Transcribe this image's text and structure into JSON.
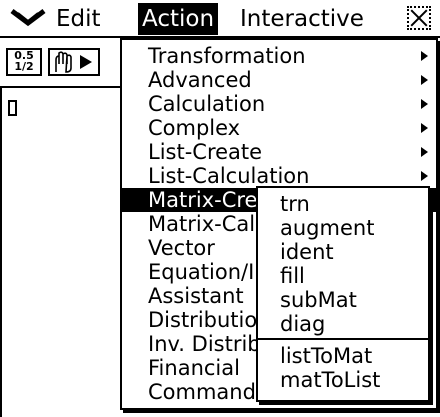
{
  "menubar": {
    "down_icon": "double-chevron-down-icon",
    "edit_label": "Edit",
    "action_label": "Action",
    "interactive_label": "Interactive",
    "close_icon": "close-icon"
  },
  "toolbar": {
    "frac_icon_text_top": "0.5",
    "frac_icon_text_bottom": "1/2",
    "hand_icon": "hand-play-icon"
  },
  "action_menu": {
    "items": [
      {
        "label": "Transformation",
        "has_submenu": true
      },
      {
        "label": "Advanced",
        "has_submenu": true
      },
      {
        "label": "Calculation",
        "has_submenu": true
      },
      {
        "label": "Complex",
        "has_submenu": true
      },
      {
        "label": "List-Create",
        "has_submenu": true
      },
      {
        "label": "List-Calculation",
        "has_submenu": true
      },
      {
        "label": "Matrix-Create",
        "has_submenu": true,
        "selected": true
      },
      {
        "label": "Matrix-Calculation",
        "has_submenu": true
      },
      {
        "label": "Vector",
        "has_submenu": true
      },
      {
        "label": "Equation/Inequality",
        "has_submenu": true
      },
      {
        "label": "Assistant",
        "has_submenu": true
      },
      {
        "label": "Distribution",
        "has_submenu": true
      },
      {
        "label": "Inv. Distribution",
        "has_submenu": true
      },
      {
        "label": "Financial",
        "has_submenu": true
      },
      {
        "label": "Command",
        "has_submenu": true
      }
    ]
  },
  "sub_menu": {
    "items": [
      "trn",
      "augment",
      "ident",
      "fill",
      "subMat",
      "diag"
    ],
    "items_after_separator": [
      "listToMat",
      "matToList"
    ]
  }
}
